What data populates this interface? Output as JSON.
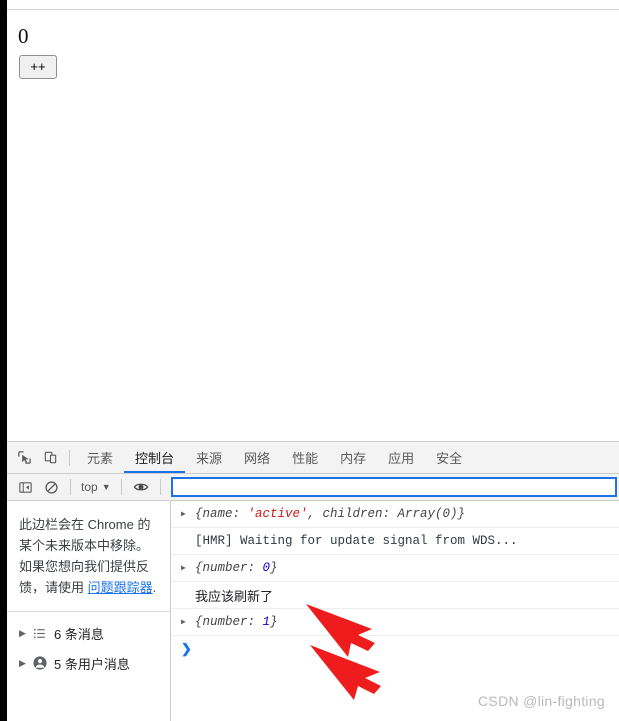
{
  "page": {
    "counter_value": "0",
    "increment_label": "++"
  },
  "devtools": {
    "toolbar_icons": [
      {
        "name": "inspect-element-icon",
        "title": "检查元素"
      },
      {
        "name": "device-toolbar-icon",
        "title": "切换设备工具栏"
      }
    ],
    "tabs": [
      {
        "label": "元素",
        "active": false
      },
      {
        "label": "控制台",
        "active": true
      },
      {
        "label": "来源",
        "active": false
      },
      {
        "label": "网络",
        "active": false
      },
      {
        "label": "性能",
        "active": false
      },
      {
        "label": "内存",
        "active": false
      },
      {
        "label": "应用",
        "active": false
      },
      {
        "label": "安全",
        "active": false
      }
    ],
    "console_toolbar": {
      "sidebar_toggle_icon": "sidebar-toggle-icon",
      "clear_console_icon": "clear-console-icon",
      "context_label": "top",
      "context_caret": "▼",
      "eye_icon": "live-expression-eye-icon",
      "filter_value": "",
      "filter_placeholder": ""
    },
    "sidebar": {
      "notice_text": "此边栏会在 Chrome 的某个未来版本中移除。如果您想向我们提供反馈，请使用 ",
      "notice_link": "问题跟踪器",
      "notice_suffix": ".",
      "groups": [
        {
          "caret": "▶",
          "icon": "list-icon",
          "label": "6 条消息"
        },
        {
          "caret": "▶",
          "icon": "user-icon",
          "label": "5 条用户消息"
        }
      ]
    },
    "messages": [
      {
        "expandable": true,
        "caret": "▶",
        "kind": "object",
        "parts": [
          {
            "text": "{name: ",
            "style": "plain"
          },
          {
            "text": "'active'",
            "style": "string"
          },
          {
            "text": ", children: Array(0)}",
            "style": "plain"
          }
        ]
      },
      {
        "expandable": false,
        "caret": "",
        "kind": "text",
        "parts": [
          {
            "text": "[HMR] Waiting for update signal from WDS...",
            "style": "mono"
          }
        ]
      },
      {
        "expandable": true,
        "caret": "▶",
        "kind": "object",
        "parts": [
          {
            "text": "{number: ",
            "style": "plain"
          },
          {
            "text": "0",
            "style": "number"
          },
          {
            "text": "}",
            "style": "plain"
          }
        ]
      },
      {
        "expandable": false,
        "caret": "",
        "kind": "cn",
        "parts": [
          {
            "text": "我应该刷新了",
            "style": "cn"
          }
        ]
      },
      {
        "expandable": true,
        "caret": "▶",
        "kind": "object",
        "parts": [
          {
            "text": "{number: ",
            "style": "plain"
          },
          {
            "text": "1",
            "style": "number"
          },
          {
            "text": "}",
            "style": "plain"
          }
        ]
      }
    ],
    "prompt_symbol": "❯"
  },
  "annotations": {
    "arrow_color": "#ee1c1c",
    "arrow_count": 2
  },
  "watermark": "CSDN @lin-fighting",
  "colors": {
    "accent_blue": "#1a73e8",
    "string_red": "#c41a16",
    "number_blue": "#1c00cf",
    "toolbar_bg": "#f3f3f3",
    "border": "#cdcdcd"
  }
}
